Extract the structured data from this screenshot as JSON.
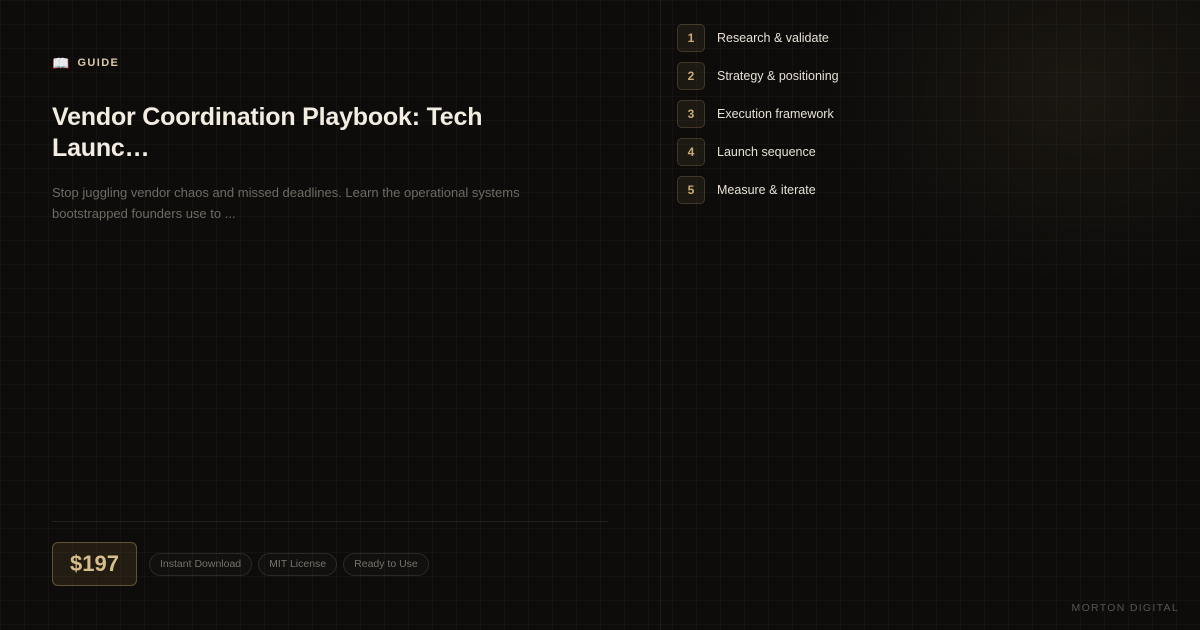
{
  "header": {
    "badge_icon": "open-book-icon",
    "badge_glyph": "📖",
    "badge_label": "GUIDE"
  },
  "title": "Vendor Coordination Playbook: Tech Launc…",
  "description": "Stop juggling vendor chaos and missed deadlines. Learn the operational systems bootstrapped founders use to ...",
  "price": "$197",
  "tags": [
    "Instant Download",
    "MIT License",
    "Ready to Use"
  ],
  "steps": [
    {
      "num": "1",
      "label": "Research & validate"
    },
    {
      "num": "2",
      "label": "Strategy & positioning"
    },
    {
      "num": "3",
      "label": "Execution framework"
    },
    {
      "num": "4",
      "label": "Launch sequence"
    },
    {
      "num": "5",
      "label": "Measure & iterate"
    }
  ],
  "brand": "MORTON DIGITAL",
  "colors": {
    "background": "#0d0c0b",
    "accent": "#d7bd8a",
    "text_primary": "#f2ece1",
    "text_muted": "#6f6a62"
  }
}
